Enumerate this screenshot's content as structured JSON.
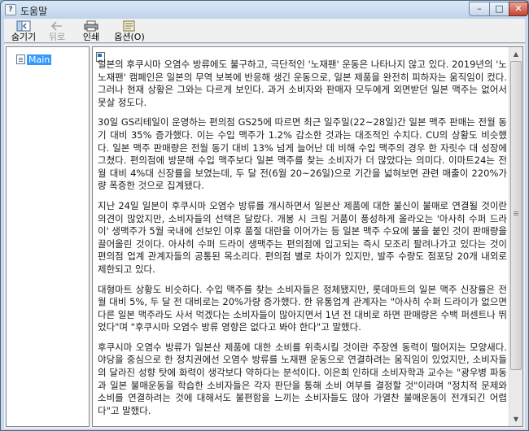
{
  "window": {
    "title": "도움말",
    "buttons": {
      "minimize": "–",
      "maximize": "□",
      "close": "✕"
    }
  },
  "toolbar": {
    "hide": {
      "label": "숨기기",
      "icon": "hide-icon"
    },
    "back": {
      "label": "뒤로",
      "icon": "back-arrow-icon",
      "disabled": true
    },
    "print": {
      "label": "인쇄",
      "icon": "print-icon"
    },
    "options": {
      "label": "옵션(O)",
      "icon": "options-icon"
    }
  },
  "nav": {
    "items": [
      {
        "label": "Main",
        "selected": true
      }
    ]
  },
  "content": {
    "paragraphs": [
      "일본의 후쿠시마 오염수 방류에도 불구하고, 극단적인 '노재팬' 운동은 나타나지 않고 있다. 2019년의 '노노재팬' 캠페인은 일본의 무역 보복에 반응해 생긴 운동으로, 일본 제품을 완전히 피하자는 움직임이 컸다. 그러나 현재 상황은 그와는 다르게 보인다. 과거 소비자와 판매자 모두에게 외면받던 일본 맥주는 없어서 못살 정도다.",
      "30일 GS리테일이 운영하는 편의점 GS25에 따르면 최근 일주일(22~28일)간 일본 맥주 판매는 전월 동기 대비 35% 증가했다. 이는 수입 맥주가 1.2% 감소한 것과는 대조적인 수치다. CU의 상황도 비슷했다. 일본 맥주 판매량은 전월 동기 대비 13% 넘게 늘어난 데 비해 수입 맥주의 경우 한 자릿수 대 성장에 그쳤다. 편의점에 방문해 수입 맥주보다 일본 맥주를 찾는 소비자가 더 많았다는 의미다. 이마트24는 전월 대비 4%대 신장률을 보였는데, 두 달 전(6월 20~26일)으로 기간을 넓혀보면 관련 매출이 220%가량 폭증한 것으로 집계됐다.",
      "지난 24일 일본이 후쿠시마 오염수 방류를 개시하면서 일본산 제품에 대한 불신이 불매로 연결될 것이란 의견이 많았지만, 소비자들의 선택은 달랐다. 개봉 시 크림 거품이 풍성하게 올라오는 '아사히 수퍼 드라이' 생맥주가 5월 국내에 선보인 이후 품절 대란을 이어가는 등 일본 맥주 수요에 불을 붙인 것이 판매량을 끌어올린 것이다. 아사히 수퍼 드라이 생맥주는 편의점에 입고되는 즉시 모조리 팔려나가고 있다는 것이 편의점 업계 관계자들의 공통된 목소리다. 편의점 별로 차이가 있지만, 발주 수량도 점포당 20개 내외로 제한되고 있다.",
      "대형마트 상황도 비슷하다. 수입 맥주를 찾는 소비자들은 정체됐지만, 롯데마트의 일본 맥주 신장률은 전월 대비 5%, 두 달 전 대비로는 20%가량 증가했다. 한 유통업계 관계자는 \"아사히 수퍼 드라이가 없으면 다른 일본 맥주라도 사서 먹겠다는 소비자들이 많아지면서 1년 전 대비로 하면 판매량은 수백 퍼센트나 뛰었다\"며 \"후쿠시마 오염수 방류 영향은 없다고 봐야 한다\"고 말했다.",
      "후쿠시마 오염수 방류가 일본산 제품에 대한 소비를 위축시킬 것이란 주장엔 동력이 떨어지는 모양새다. 야당을 중심으로 한 정치권에선 오염수 방류를 노재팬 운동으로 연결하려는 움직임이 있었지만, 소비자들의 달라진 성향 탓에 화력이 생각보다 약하다는 분석이다. 이은희 인하대 소비자학과 교수는 \"광우병 파동과 일본 불매운동을 학습한 소비자들은 각자 판단을 통해 소비 여부를 결정할 것\"이라며 \"정치적 문제와 소비를 연결하려는 것에 대해서도 불편함을 느끼는 소비자들도 많아 가열찬 불매운동이 전개되긴 어렵다\"고 말했다."
    ]
  },
  "scrollbar": {
    "up_icon": "▲",
    "down_icon": "▼"
  }
}
